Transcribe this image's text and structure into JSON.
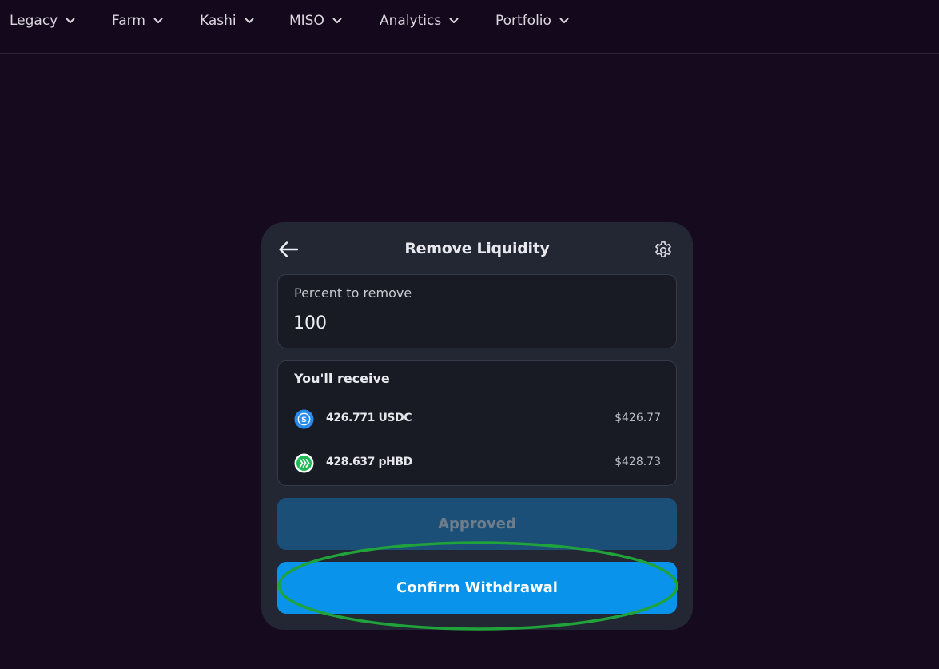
{
  "nav": {
    "items": [
      {
        "label": "Legacy",
        "icon": "chevron-down-icon"
      },
      {
        "label": "Farm",
        "icon": "chevron-down-icon"
      },
      {
        "label": "Kashi",
        "icon": "chevron-down-icon"
      },
      {
        "label": "MISO",
        "icon": "chevron-down-icon"
      },
      {
        "label": "Analytics",
        "icon": "chevron-down-icon"
      },
      {
        "label": "Portfolio",
        "icon": "chevron-down-icon"
      }
    ]
  },
  "modal": {
    "title": "Remove Liquidity",
    "back_icon": "arrow-left-icon",
    "settings_icon": "gear-icon",
    "percent": {
      "label": "Percent to remove",
      "value": "100"
    },
    "receive": {
      "title": "You'll receive",
      "tokens": [
        {
          "amount": "426.771 USDC",
          "usd": "$426.77",
          "icon": "usdc-token-icon",
          "color": "#2775ca"
        },
        {
          "amount": "428.637 pHBD",
          "usd": "$428.73",
          "icon": "phbd-token-icon",
          "color": "#1db954"
        }
      ]
    },
    "approved_label": "Approved",
    "confirm_label": "Confirm Withdrawal"
  },
  "colors": {
    "background": "#150a1e",
    "card": "#232733",
    "panel": "#181a24",
    "confirm_button": "#0993ea",
    "approved_button": "#1c4f78",
    "highlight_ellipse": "#1fa33a"
  }
}
